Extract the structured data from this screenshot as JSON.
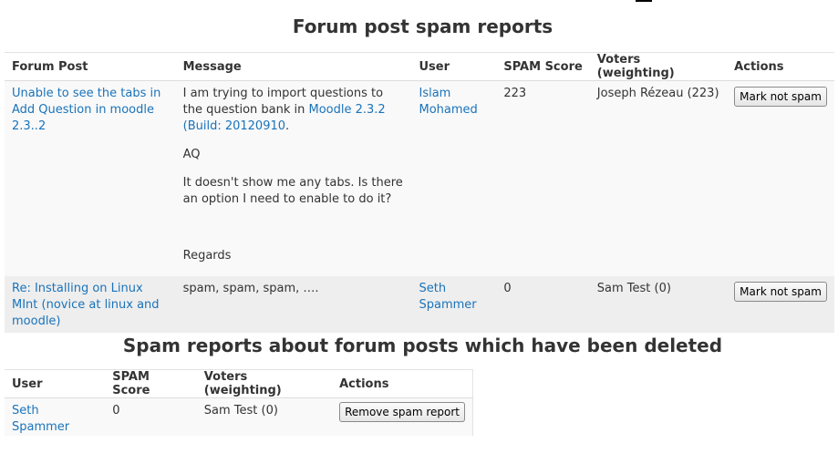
{
  "page": {
    "title": "Forum post spam reports",
    "deleted_title": "Spam reports about forum posts which have been deleted"
  },
  "reports_table": {
    "headers": {
      "forum_post": "Forum Post",
      "message": "Message",
      "user": "User",
      "spam_score": "SPAM Score",
      "voters": "Voters (weighting)",
      "actions": "Actions"
    },
    "rows": [
      {
        "post_title": "Unable to see the tabs in Add Question in moodle 2.3..2",
        "message": {
          "p1_text": "I am trying to import questions to the question bank in ",
          "p1_link": "Moodle 2.3.2 (Build: 20120910",
          "p1_end": ".",
          "p2": "AQ",
          "p3": "It doesn't show me any tabs. Is there an option I need to enable to do it?",
          "p4": "Regards"
        },
        "user": "Islam Mohamed",
        "spam_score": "223",
        "voters": "Joseph Rézeau (223)",
        "action_label": "Mark not spam"
      },
      {
        "post_title": "Re: Installing on Linux MInt (novice at linux and moodle)",
        "message": {
          "p1_text": "spam, spam, spam, …."
        },
        "user": "Seth Spammer",
        "spam_score": "0",
        "voters": "Sam Test (0)",
        "action_label": "Mark not spam"
      }
    ]
  },
  "deleted_table": {
    "headers": {
      "user": "User",
      "spam_score": "SPAM Score",
      "voters": "Voters (weighting)",
      "actions": "Actions"
    },
    "rows": [
      {
        "user": "Seth Spammer",
        "spam_score": "0",
        "voters": "Sam Test (0)",
        "action_label": "Remove spam report"
      }
    ]
  },
  "colors": {
    "link": "#1a73ba",
    "text": "#333333",
    "row_odd": "#f9f9f9",
    "row_even": "#eeeeee"
  }
}
